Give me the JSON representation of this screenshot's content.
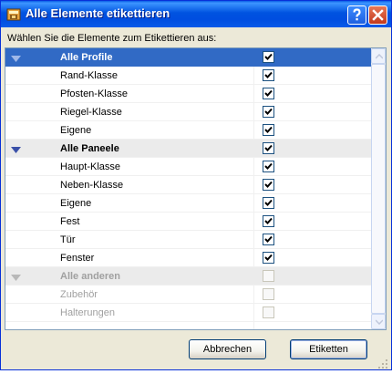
{
  "window": {
    "title": "Alle Elemente etikettieren"
  },
  "instruction": "Wählen Sie die Elemente zum Etikettieren aus:",
  "rows": [
    {
      "label": "Alle Profile",
      "kind": "group",
      "checked": true,
      "selected": true,
      "disabled": false
    },
    {
      "label": "Rand-Klasse",
      "kind": "item",
      "checked": true,
      "selected": false,
      "disabled": false
    },
    {
      "label": "Pfosten-Klasse",
      "kind": "item",
      "checked": true,
      "selected": false,
      "disabled": false
    },
    {
      "label": "Riegel-Klasse",
      "kind": "item",
      "checked": true,
      "selected": false,
      "disabled": false
    },
    {
      "label": "Eigene",
      "kind": "item",
      "checked": true,
      "selected": false,
      "disabled": false
    },
    {
      "label": "Alle Paneele",
      "kind": "group",
      "checked": true,
      "selected": false,
      "disabled": false
    },
    {
      "label": "Haupt-Klasse",
      "kind": "item",
      "checked": true,
      "selected": false,
      "disabled": false
    },
    {
      "label": "Neben-Klasse",
      "kind": "item",
      "checked": true,
      "selected": false,
      "disabled": false
    },
    {
      "label": "Eigene",
      "kind": "item",
      "checked": true,
      "selected": false,
      "disabled": false
    },
    {
      "label": "Fest",
      "kind": "item",
      "checked": true,
      "selected": false,
      "disabled": false
    },
    {
      "label": "Tür",
      "kind": "item",
      "checked": true,
      "selected": false,
      "disabled": false
    },
    {
      "label": "Fenster",
      "kind": "item",
      "checked": true,
      "selected": false,
      "disabled": false
    },
    {
      "label": "Alle anderen",
      "kind": "group",
      "checked": false,
      "selected": false,
      "disabled": true
    },
    {
      "label": "Zubehör",
      "kind": "item",
      "checked": false,
      "selected": false,
      "disabled": true
    },
    {
      "label": "Halterungen",
      "kind": "item",
      "checked": false,
      "selected": false,
      "disabled": true
    }
  ],
  "buttons": {
    "cancel": "Abbrechen",
    "ok": "Etiketten"
  },
  "icons": {
    "help": "help-icon",
    "close": "close-icon",
    "app": "app-icon",
    "collapse": "collapse-triangle-icon",
    "check": "checkmark-icon"
  },
  "colors": {
    "titlebar": "#0054e3",
    "selection": "#316ac5",
    "group_row": "#ebebeb",
    "disabled_text": "#a0a0a0",
    "close_button": "#d4512c"
  }
}
